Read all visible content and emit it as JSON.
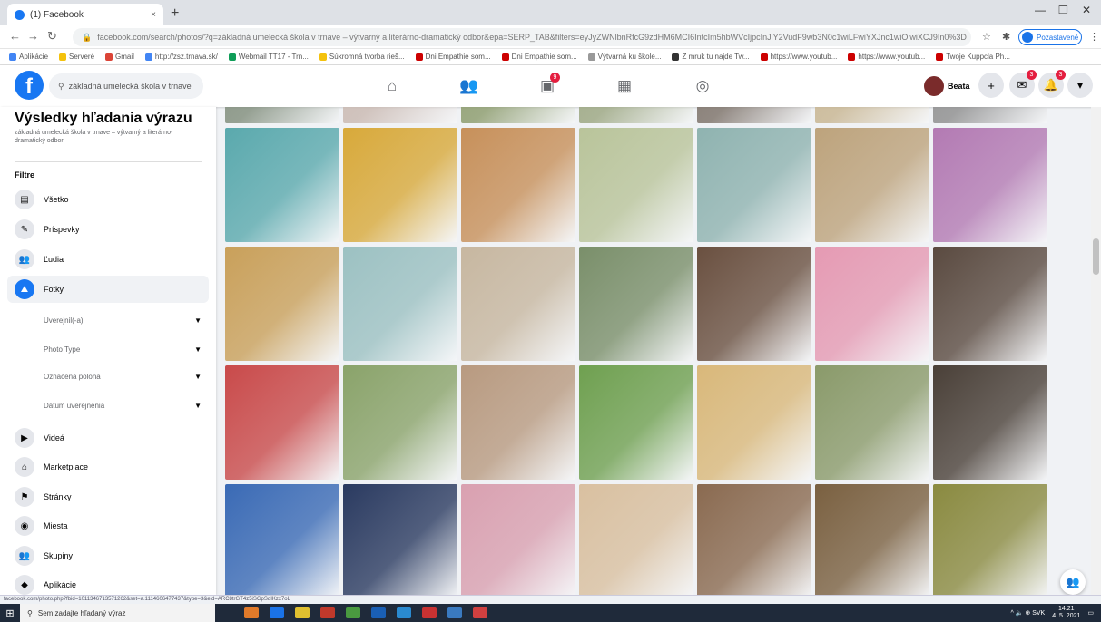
{
  "browser": {
    "tab_title": "(1) Facebook",
    "tab_close": "×",
    "new_tab": "+",
    "window_controls": [
      "—",
      "❐",
      "✕"
    ],
    "url": "facebook.com/search/photos/?q=základná umelecká škola v trnave – výtvarný a literárno-dramatický odbor&epa=SERP_TAB&filters=eyJyZWNlbnRfcG9zdHM6MCI6IntcIm5hbWVcIjpcInJlY2VudF9wb3N0c1wiLFwiYXJnc1wiOlwiXCJ9In0%3D",
    "profile_label": "Pozastavené",
    "bookmarks": [
      {
        "label": "Aplikácie",
        "color": "#4285f4"
      },
      {
        "label": "Serveré",
        "color": "#f4c20d"
      },
      {
        "label": "Gmail",
        "color": "#db4437"
      },
      {
        "label": "http://zsz.trnava.sk/",
        "color": "#4285f4"
      },
      {
        "label": "Webmail TT17 - Trn...",
        "color": "#0f9d58"
      },
      {
        "label": "Súkromná tvorba rieš...",
        "color": "#f4c20d"
      },
      {
        "label": "Dni Empathie som...",
        "color": "#cc0000"
      },
      {
        "label": "Dni Empathie som...",
        "color": "#cc0000"
      },
      {
        "label": "Výtvarná ku škole...",
        "color": "#999999"
      },
      {
        "label": "Z mruk tu najde Tw...",
        "color": "#333333"
      },
      {
        "label": "https://www.youtub...",
        "color": "#cc0000"
      },
      {
        "label": "https://www.youtub...",
        "color": "#cc0000"
      },
      {
        "label": "Twoje Kuppcla Ph...",
        "color": "#cc0000"
      }
    ]
  },
  "fbnav": {
    "logo": "f",
    "search_value": "základná umelecká škola v trnave",
    "badges": {
      "groups": "9",
      "messenger": "3",
      "notifications": "3"
    },
    "user_name": "Beata"
  },
  "sidebar": {
    "title": "Výsledky hľadania výrazu",
    "subtitle": "základná umelecká škola v trnave – výtvarný a literárno-dramatický odbor",
    "filters_label": "Filtre",
    "items_top": [
      {
        "label": "Všetko",
        "icon": "▤"
      },
      {
        "label": "Príspevky",
        "icon": "✎"
      },
      {
        "label": "Ľudia",
        "icon": "👥"
      },
      {
        "label": "Fotky",
        "icon": "⛰"
      }
    ],
    "subfilters": [
      "Uverejnil(-a)",
      "Photo Type",
      "Označená poloha",
      "Dátum uverejnenia"
    ],
    "items_bottom": [
      {
        "label": "Videá",
        "icon": "▶"
      },
      {
        "label": "Marketplace",
        "icon": "⌂"
      },
      {
        "label": "Stránky",
        "icon": "⚑"
      },
      {
        "label": "Miesta",
        "icon": "◉"
      },
      {
        "label": "Skupiny",
        "icon": "👥"
      },
      {
        "label": "Aplikácie",
        "icon": "◆"
      }
    ]
  },
  "grid": {
    "rows": [
      [
        "#7f8c7a",
        "#c9b8b0",
        "#8a9a6a",
        "#9aa57f",
        "#7a6f66",
        "#c7b48f",
        "#8c8c8c"
      ],
      [
        "#5aa9ad",
        "#d8a93a",
        "#c7905a",
        "#b9c49a",
        "#8fb3b0",
        "#bda37c",
        "#b37ab3"
      ],
      [
        "#c9a05a",
        "#9cc1c2",
        "#c7b7a0",
        "#7a8f6a",
        "#6a5040",
        "#e59ab3",
        "#5a4a40"
      ],
      [
        "#c94a4a",
        "#8aa36a",
        "#b89a80",
        "#6fa050",
        "#d9b87a",
        "#8a9a6a",
        "#4a4038"
      ],
      [
        "#3a6ab5",
        "#2a3a60",
        "#d9a0b0",
        "#d9c0a0",
        "#8a6a50",
        "#7a6040",
        "#8a8a40"
      ]
    ]
  },
  "statusbar_url": "facebook.com/photo.php?fbid=1011346713571262&set=a.1114606477437&type=3&eid=ARC8trGT4z5iSGpSqIKzx7oL",
  "taskbar": {
    "start": "⊞",
    "search_placeholder": "Sem zadajte hľadaný výraz",
    "apps": [
      "#e07a2a",
      "#1a73e8",
      "#e0c030",
      "#c0392b",
      "#4a9a40",
      "#1a5fb4",
      "#2a8ad0",
      "#c83232",
      "#3a7ac0",
      "#d04040"
    ],
    "tray_icons": "^ 🔈 ⊕ SVK",
    "time": "14:21",
    "date": "4. 5. 2021"
  }
}
